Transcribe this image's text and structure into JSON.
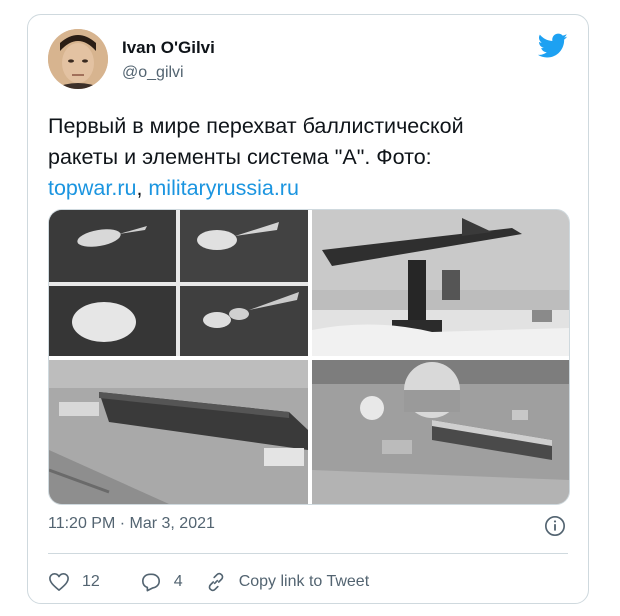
{
  "tweet": {
    "author_name": "Ivan O'Gilvi",
    "author_handle": "@o_gilvi",
    "text_line1": "Первый в мире перехват баллистической",
    "text_line2": "ракеты и элементы система \"А\". Фото:",
    "link1": "topwar.ru",
    "separator": ", ",
    "link2": "militaryrussia.ru",
    "timestamp": "11:20 PM · Mar 3, 2021"
  },
  "actions": {
    "likes": "12",
    "replies": "4",
    "copy_link": "Copy link to Tweet"
  },
  "colors": {
    "link": "#1b95e0",
    "twitter_blue": "#1da1f2",
    "secondary_text": "#536471",
    "border": "#cfd9de"
  },
  "icons": [
    "twitter-bird-icon",
    "info-icon",
    "heart-icon",
    "reply-icon",
    "link-icon"
  ]
}
